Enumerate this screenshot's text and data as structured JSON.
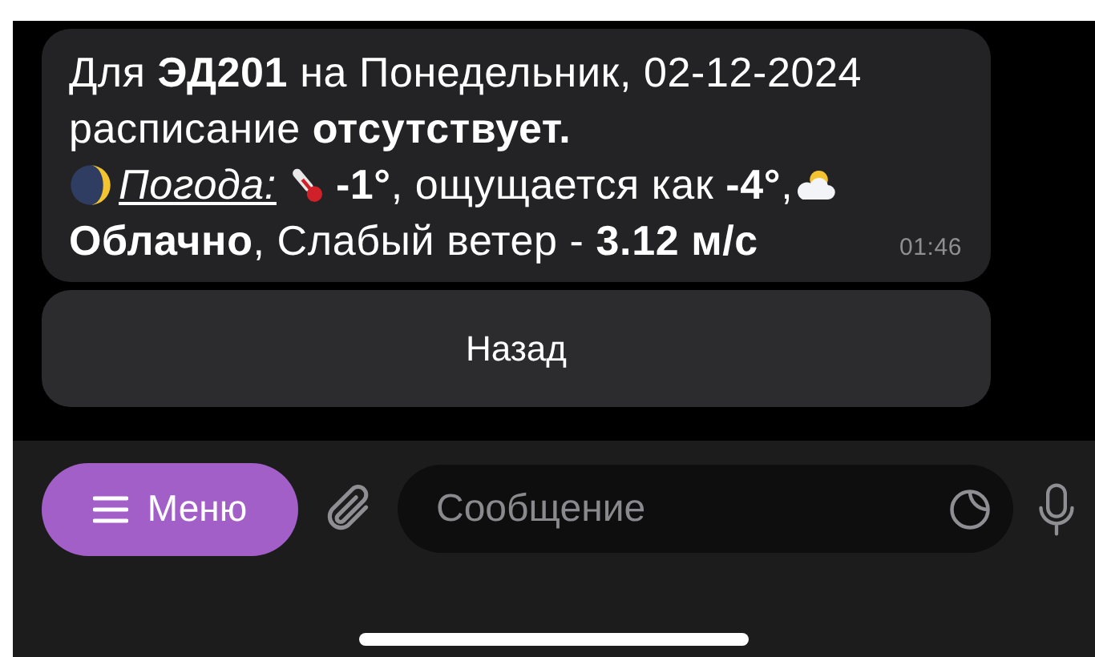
{
  "message": {
    "line_1": "Для **ЭД201** на Понедельник, 02-12-2024",
    "line_2": "расписание **отсутствует.**",
    "weather_label": "Погода:",
    "temperature": "**-1°**, ощущается как **-4°**,",
    "conditions": "**Облачно**, Слабый ветер - **3.12 м/с**",
    "time": "01:46"
  },
  "keyboard_buttons": [
    "Назад"
  ],
  "input_bar": {
    "menu_label": "Меню",
    "placeholder": "Сообщение"
  }
}
